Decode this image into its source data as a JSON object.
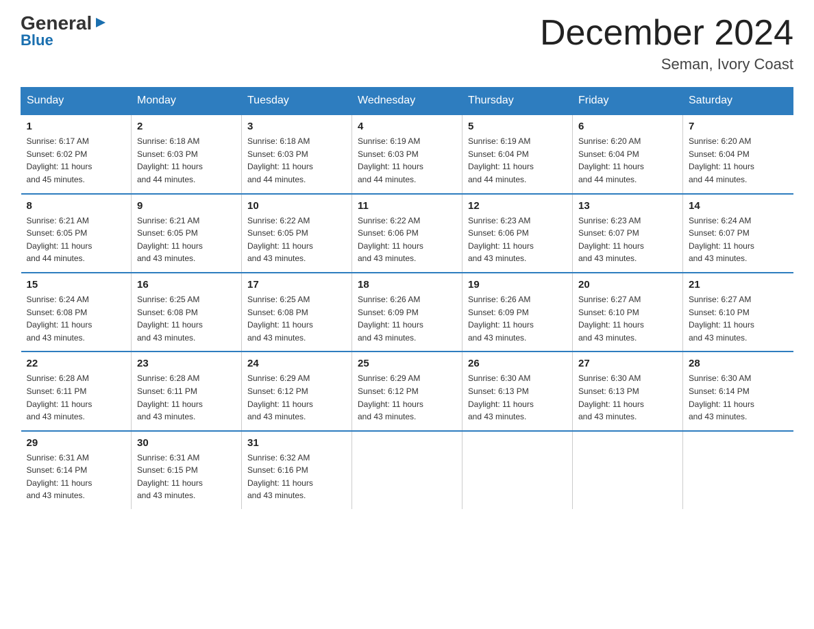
{
  "logo": {
    "line1": "General",
    "arrow": "▶",
    "line2": "Blue"
  },
  "header": {
    "title": "December 2024",
    "location": "Seman, Ivory Coast"
  },
  "days_of_week": [
    "Sunday",
    "Monday",
    "Tuesday",
    "Wednesday",
    "Thursday",
    "Friday",
    "Saturday"
  ],
  "weeks": [
    [
      {
        "day": "1",
        "sunrise": "6:17 AM",
        "sunset": "6:02 PM",
        "daylight": "11 hours and 45 minutes."
      },
      {
        "day": "2",
        "sunrise": "6:18 AM",
        "sunset": "6:03 PM",
        "daylight": "11 hours and 44 minutes."
      },
      {
        "day": "3",
        "sunrise": "6:18 AM",
        "sunset": "6:03 PM",
        "daylight": "11 hours and 44 minutes."
      },
      {
        "day": "4",
        "sunrise": "6:19 AM",
        "sunset": "6:03 PM",
        "daylight": "11 hours and 44 minutes."
      },
      {
        "day": "5",
        "sunrise": "6:19 AM",
        "sunset": "6:04 PM",
        "daylight": "11 hours and 44 minutes."
      },
      {
        "day": "6",
        "sunrise": "6:20 AM",
        "sunset": "6:04 PM",
        "daylight": "11 hours and 44 minutes."
      },
      {
        "day": "7",
        "sunrise": "6:20 AM",
        "sunset": "6:04 PM",
        "daylight": "11 hours and 44 minutes."
      }
    ],
    [
      {
        "day": "8",
        "sunrise": "6:21 AM",
        "sunset": "6:05 PM",
        "daylight": "11 hours and 44 minutes."
      },
      {
        "day": "9",
        "sunrise": "6:21 AM",
        "sunset": "6:05 PM",
        "daylight": "11 hours and 43 minutes."
      },
      {
        "day": "10",
        "sunrise": "6:22 AM",
        "sunset": "6:05 PM",
        "daylight": "11 hours and 43 minutes."
      },
      {
        "day": "11",
        "sunrise": "6:22 AM",
        "sunset": "6:06 PM",
        "daylight": "11 hours and 43 minutes."
      },
      {
        "day": "12",
        "sunrise": "6:23 AM",
        "sunset": "6:06 PM",
        "daylight": "11 hours and 43 minutes."
      },
      {
        "day": "13",
        "sunrise": "6:23 AM",
        "sunset": "6:07 PM",
        "daylight": "11 hours and 43 minutes."
      },
      {
        "day": "14",
        "sunrise": "6:24 AM",
        "sunset": "6:07 PM",
        "daylight": "11 hours and 43 minutes."
      }
    ],
    [
      {
        "day": "15",
        "sunrise": "6:24 AM",
        "sunset": "6:08 PM",
        "daylight": "11 hours and 43 minutes."
      },
      {
        "day": "16",
        "sunrise": "6:25 AM",
        "sunset": "6:08 PM",
        "daylight": "11 hours and 43 minutes."
      },
      {
        "day": "17",
        "sunrise": "6:25 AM",
        "sunset": "6:08 PM",
        "daylight": "11 hours and 43 minutes."
      },
      {
        "day": "18",
        "sunrise": "6:26 AM",
        "sunset": "6:09 PM",
        "daylight": "11 hours and 43 minutes."
      },
      {
        "day": "19",
        "sunrise": "6:26 AM",
        "sunset": "6:09 PM",
        "daylight": "11 hours and 43 minutes."
      },
      {
        "day": "20",
        "sunrise": "6:27 AM",
        "sunset": "6:10 PM",
        "daylight": "11 hours and 43 minutes."
      },
      {
        "day": "21",
        "sunrise": "6:27 AM",
        "sunset": "6:10 PM",
        "daylight": "11 hours and 43 minutes."
      }
    ],
    [
      {
        "day": "22",
        "sunrise": "6:28 AM",
        "sunset": "6:11 PM",
        "daylight": "11 hours and 43 minutes."
      },
      {
        "day": "23",
        "sunrise": "6:28 AM",
        "sunset": "6:11 PM",
        "daylight": "11 hours and 43 minutes."
      },
      {
        "day": "24",
        "sunrise": "6:29 AM",
        "sunset": "6:12 PM",
        "daylight": "11 hours and 43 minutes."
      },
      {
        "day": "25",
        "sunrise": "6:29 AM",
        "sunset": "6:12 PM",
        "daylight": "11 hours and 43 minutes."
      },
      {
        "day": "26",
        "sunrise": "6:30 AM",
        "sunset": "6:13 PM",
        "daylight": "11 hours and 43 minutes."
      },
      {
        "day": "27",
        "sunrise": "6:30 AM",
        "sunset": "6:13 PM",
        "daylight": "11 hours and 43 minutes."
      },
      {
        "day": "28",
        "sunrise": "6:30 AM",
        "sunset": "6:14 PM",
        "daylight": "11 hours and 43 minutes."
      }
    ],
    [
      {
        "day": "29",
        "sunrise": "6:31 AM",
        "sunset": "6:14 PM",
        "daylight": "11 hours and 43 minutes."
      },
      {
        "day": "30",
        "sunrise": "6:31 AM",
        "sunset": "6:15 PM",
        "daylight": "11 hours and 43 minutes."
      },
      {
        "day": "31",
        "sunrise": "6:32 AM",
        "sunset": "6:16 PM",
        "daylight": "11 hours and 43 minutes."
      },
      null,
      null,
      null,
      null
    ]
  ],
  "labels": {
    "sunrise_prefix": "Sunrise: ",
    "sunset_prefix": "Sunset: ",
    "daylight_prefix": "Daylight: "
  }
}
